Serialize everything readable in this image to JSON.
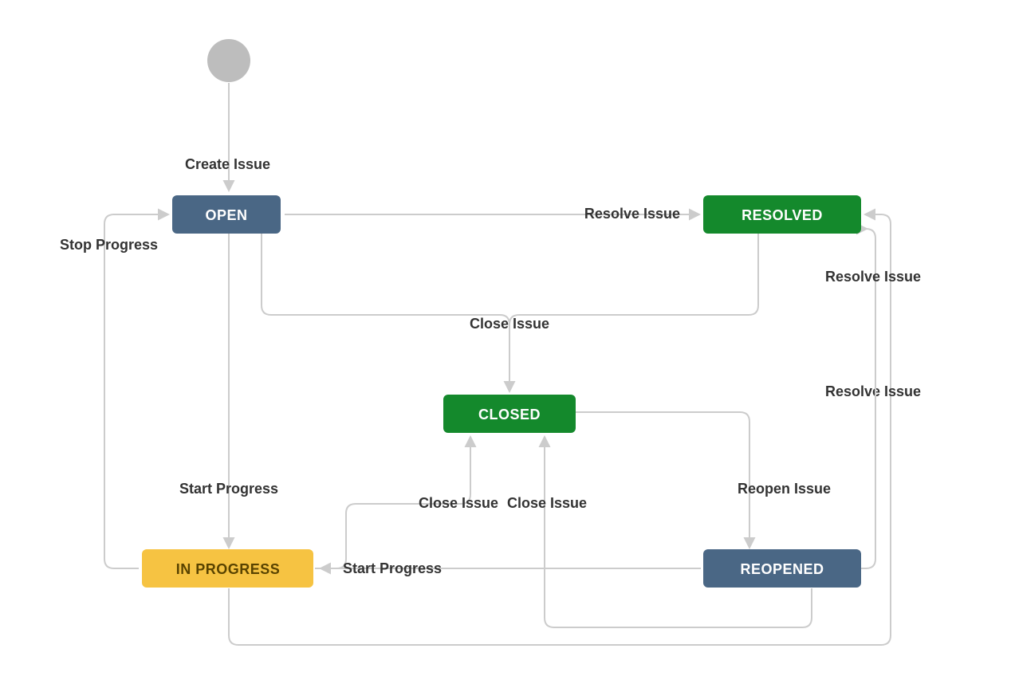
{
  "states": {
    "open": {
      "label": "OPEN",
      "color": "blue"
    },
    "resolved": {
      "label": "RESOLVED",
      "color": "green"
    },
    "closed": {
      "label": "CLOSED",
      "color": "green"
    },
    "inprogress": {
      "label": "IN PROGRESS",
      "color": "yellow"
    },
    "reopened": {
      "label": "REOPENED",
      "color": "blue"
    }
  },
  "transitions": {
    "create": "Create Issue",
    "stop_progress": "Stop Progress",
    "resolve_open": "Resolve Issue",
    "close_from_open": "Close Issue",
    "start_progress_open": "Start Progress",
    "close_from_inprogress": "Close Issue",
    "close_from_reopened": "Close Issue",
    "reopen": "Reopen Issue",
    "start_progress_reopened": "Start Progress",
    "resolve_inprogress": "Resolve Issue",
    "resolve_reopened": "Resolve Issue"
  },
  "colors": {
    "blue": "#4a6785",
    "green": "#14892c",
    "yellow": "#f6c342",
    "edge": "#cccccc",
    "text": "#333333"
  }
}
